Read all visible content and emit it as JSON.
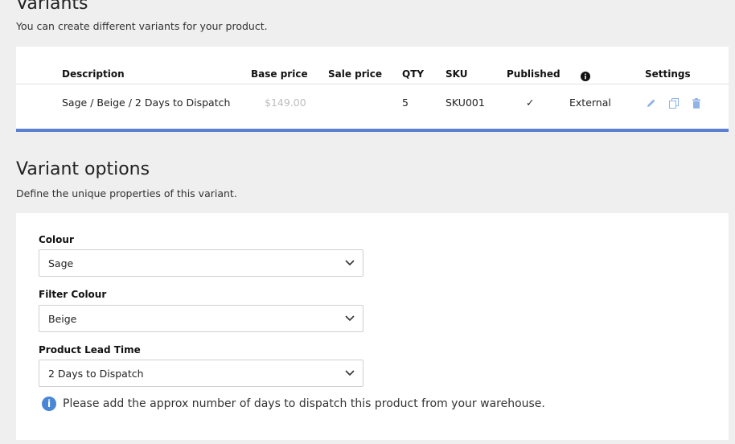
{
  "variants": {
    "title": "Variants",
    "subtitle": "You can create different variants for your product.",
    "columns": {
      "description": "Description",
      "base_price": "Base price",
      "sale_price": "Sale price",
      "qty": "QTY",
      "sku": "SKU",
      "published": "Published",
      "info": "info-circle-icon",
      "settings": "Settings"
    },
    "rows": [
      {
        "description": "Sage / Beige / 2 Days to Dispatch",
        "base_price": "$149.00",
        "sale_price": "",
        "qty": "5",
        "sku": "SKU001",
        "published": "✓",
        "info": "External",
        "actions": [
          "pencil-icon",
          "copy-icon",
          "trash-icon"
        ]
      }
    ],
    "accent_color": "#5b7fd1"
  },
  "options": {
    "title": "Variant options",
    "subtitle": "Define the unique properties of this variant.",
    "fields": [
      {
        "label": "Colour",
        "value": "Sage"
      },
      {
        "label": "Filter Colour",
        "value": "Beige"
      },
      {
        "label": "Product Lead Time",
        "value": "2 Days to Dispatch"
      }
    ],
    "hint": "Please add the approx number of days to dispatch this product from your warehouse.",
    "hint_icon": "info-icon"
  }
}
